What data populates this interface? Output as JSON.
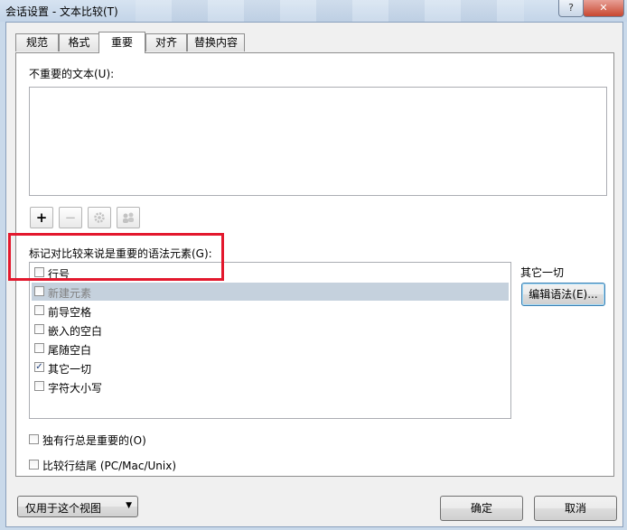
{
  "window": {
    "title": "会话设置 - 文本比较(T)",
    "help_label": "?",
    "close_label": "✕"
  },
  "tabs": [
    {
      "label": "规范"
    },
    {
      "label": "格式"
    },
    {
      "label": "重要",
      "active": true
    },
    {
      "label": "对齐"
    },
    {
      "label": "替换内容"
    }
  ],
  "unimportant_text": {
    "label": "不重要的文本(U):",
    "value": ""
  },
  "toolbar": {
    "add_label": "+",
    "remove_label": "−",
    "edit_icon": "gear-icon",
    "group_icon": "people-icon"
  },
  "grammar": {
    "label": "标记对比较来说是重要的语法元素(G):",
    "items": [
      {
        "label": "行号",
        "checked": false
      },
      {
        "label": "新建元素",
        "checked": false,
        "selected": true
      },
      {
        "label": "前导空格",
        "checked": false
      },
      {
        "label": "嵌入的空白",
        "checked": false
      },
      {
        "label": "尾随空白",
        "checked": false
      },
      {
        "label": "其它一切",
        "checked": true
      },
      {
        "label": "字符大小写",
        "checked": false
      }
    ],
    "side_label": "其它一切",
    "edit_button": "编辑语法(E)..."
  },
  "options": {
    "orphan_label": "独有行总是重要的(O)",
    "orphan_checked": false,
    "line_endings_label": "比较行结尾 (PC/Mac/Unix)",
    "line_endings_checked": false
  },
  "footer": {
    "scope_value": "仅用于这个视图",
    "ok_label": "确定",
    "cancel_label": "取消"
  },
  "colors": {
    "highlight_box": "#e3182d",
    "selected_row": "#c5d1dd"
  }
}
